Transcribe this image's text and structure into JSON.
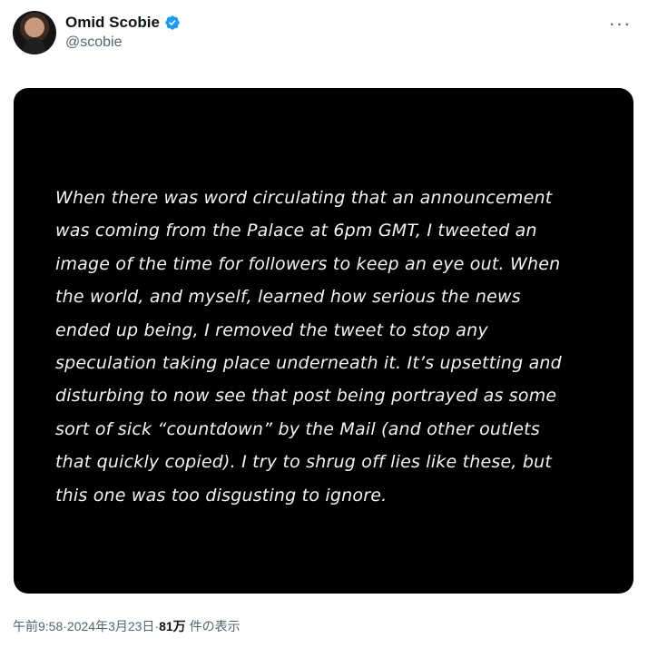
{
  "author": {
    "display_name": "Omid Scobie",
    "handle": "@scobie",
    "verified": true,
    "verified_color": "#1d9bf0"
  },
  "menu": {
    "more_icon": "ellipsis-horizontal-icon",
    "more_label": "···"
  },
  "media": {
    "background_color": "#000000",
    "statement_lines": [
      "When there was word circulating that an announcement",
      "was coming from the Palace at 6pm GMT, I tweeted an",
      "image of the time for followers to keep an eye out. When",
      "the world, and myself, learned how serious the news",
      "ended up being, I removed the tweet to stop any",
      "speculation taking place underneath it. It’s upsetting and",
      "disturbing to now see that post being portrayed as some",
      "sort of sick “countdown” by the Mail (and other outlets",
      "that quickly copied). I try to shrug off lies like these, but",
      "this one was too disgusting to ignore."
    ]
  },
  "meta": {
    "time": "午前9:58",
    "separator": " · ",
    "date": "2024年3月23日",
    "views_count": "81万",
    "views_label": "件の表示"
  }
}
